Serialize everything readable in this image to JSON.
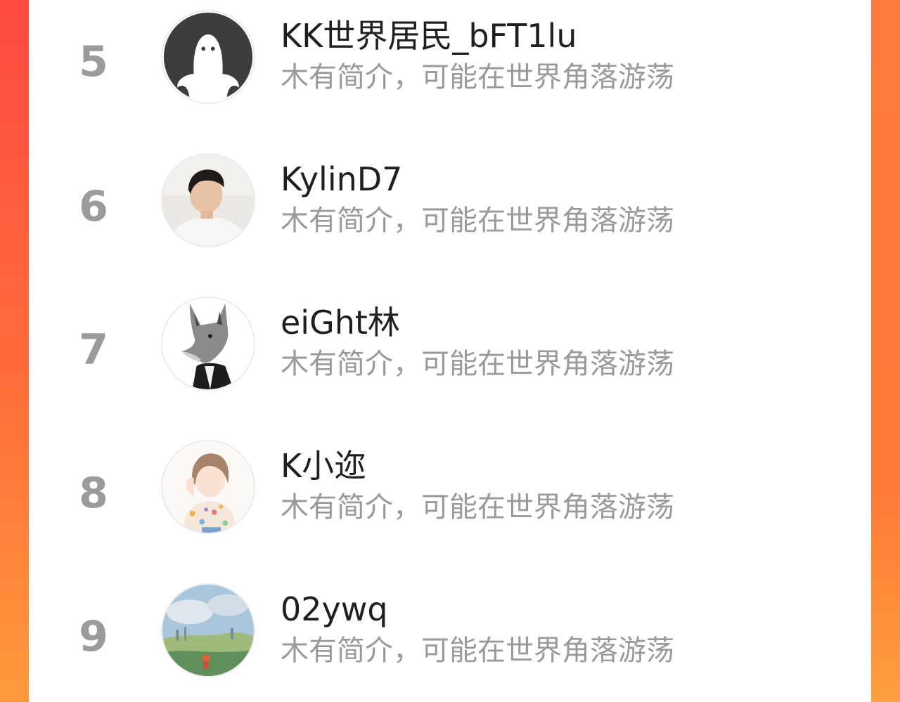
{
  "colors": {
    "background_gradient_top": "#ff4a42",
    "background_gradient_bottom": "#ff9a3c",
    "panel": "#ffffff",
    "rank_text": "#9b9b9b",
    "name_text": "#1f1f1f",
    "bio_text": "#9a9a9a"
  },
  "ranking": {
    "items": [
      {
        "rank": "5",
        "name": "KK世界居民_bFT1lu",
        "bio": "木有简介，可能在世界角落游荡",
        "avatar_icon": "default-ghost-avatar-icon"
      },
      {
        "rank": "6",
        "name": "KylinD7",
        "bio": "木有简介，可能在世界角落游荡",
        "avatar_icon": "photo-man-avatar-icon"
      },
      {
        "rank": "7",
        "name": "eiGht林",
        "bio": "木有简介，可能在世界角落游荡",
        "avatar_icon": "fox-suit-avatar-icon"
      },
      {
        "rank": "8",
        "name": "K小迩",
        "bio": "木有简介，可能在世界角落游荡",
        "avatar_icon": "illustrated-girl-avatar-icon"
      },
      {
        "rank": "9",
        "name": "02ywq",
        "bio": "木有简介，可能在世界角落游荡",
        "avatar_icon": "landscape-painting-avatar-icon"
      }
    ]
  }
}
